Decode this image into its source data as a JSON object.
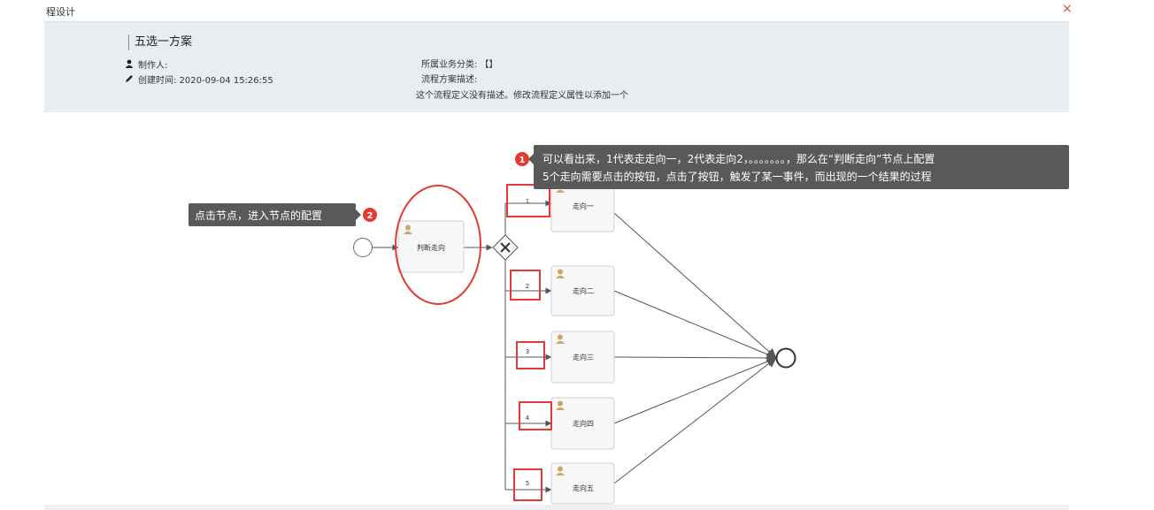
{
  "window": {
    "title": "程设计",
    "close_glyph": "×"
  },
  "header": {
    "scheme_name": "五选一方案",
    "author_label": "制作人:",
    "created_label": "创建时间: 2020-09-04 15:26:55",
    "category_label": "所属业务分类: 【】",
    "desc_label": "流程方案描述:",
    "desc_text": "这个流程定义没有描述。修改流程定义属性以添加一个"
  },
  "icons": {
    "author": "user-icon",
    "created": "pencil-icon",
    "task": "user-icon",
    "gateway": "exclusive-gateway-icon"
  },
  "annotations": [
    {
      "number": "1",
      "lines": [
        "可以看出来，1代表走走向一，2代表走向2，。。。。。。。，那么在“判断走向”节点上配置",
        "5个走向需要点击的按钮，点击了按钮，触发了某一事件，而出现的一个结果的过程"
      ]
    },
    {
      "number": "2",
      "lines": [
        "点击节点，进入节点的配置"
      ]
    }
  ],
  "diagram": {
    "decision_task": "判断走向",
    "branches": [
      {
        "flow_label": "1",
        "task": "走向一"
      },
      {
        "flow_label": "2",
        "task": "走向二"
      },
      {
        "flow_label": "3",
        "task": "走向三"
      },
      {
        "flow_label": "4",
        "task": "走向四"
      },
      {
        "flow_label": "5",
        "task": "走向五"
      }
    ]
  },
  "colors": {
    "highlight": "#e53935",
    "tooltip_bg": "#595959",
    "badge": "#e53935",
    "node_border": "#cfcfcf",
    "node_fill": "#f7f7f7",
    "edge": "#555555",
    "user_icon": "#c9a86a"
  }
}
